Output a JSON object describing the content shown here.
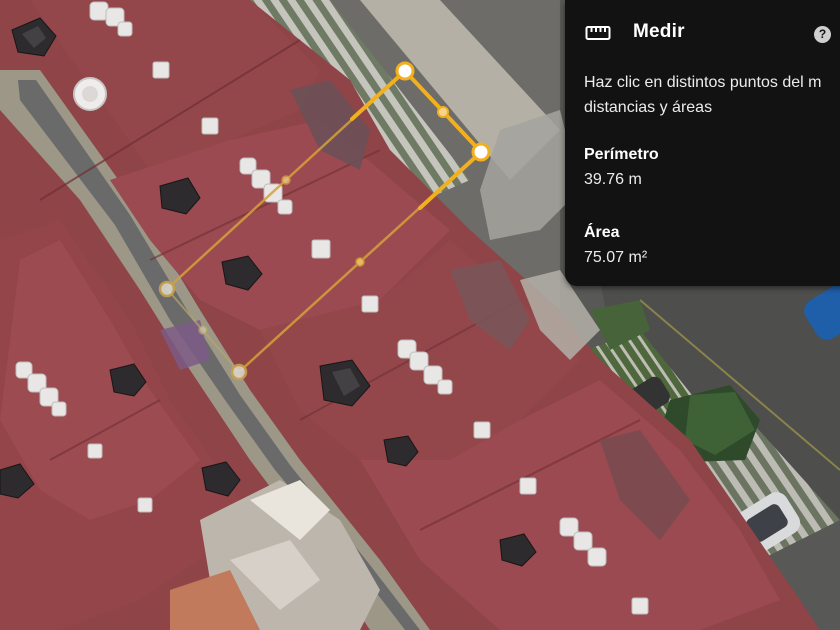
{
  "panel": {
    "title": "Medir",
    "title_icon": "ruler-icon",
    "help_icon": "help-icon",
    "help_glyph": "?",
    "instructions_line1": "Haz clic en distintos puntos del m",
    "instructions_line2": "distancias y áreas",
    "perimeter": {
      "label": "Perímetro",
      "value": "39.76 m"
    },
    "area": {
      "label": "Área",
      "value": "75.07 m²"
    }
  },
  "map": {
    "view": "satellite-3d",
    "measure_color": "#f2b01e",
    "roof_color": "#9b4a4f"
  }
}
